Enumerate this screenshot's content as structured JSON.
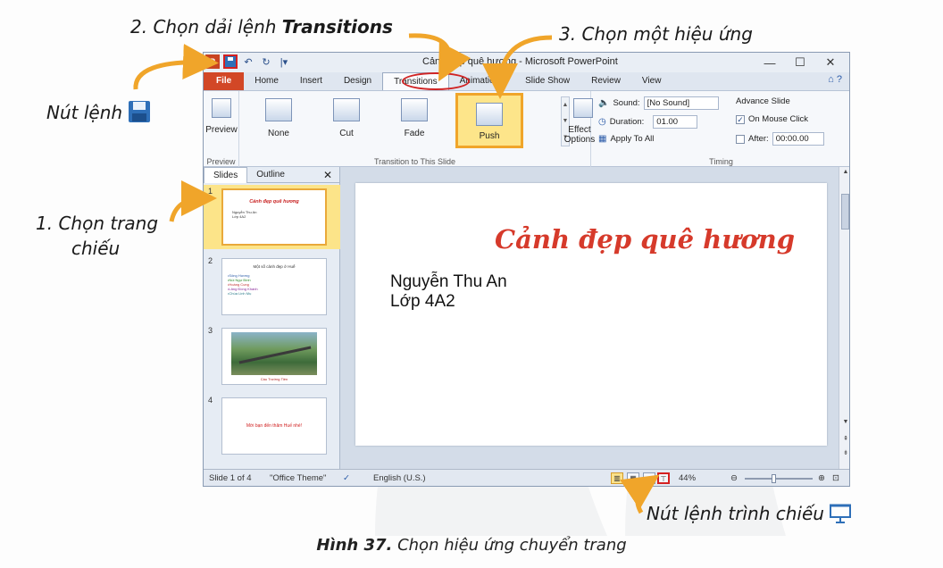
{
  "annotations": {
    "step2_prefix": "2. Chọn dải lệnh ",
    "step2_bold": "Transitions",
    "step3": "3. Chọn một hiệu ứng",
    "save_note": "Nút lệnh",
    "step1_line1": "1. Chọn trang",
    "step1_line2": "chiếu",
    "slideshow_note": "Nút lệnh trình chiếu",
    "caption_bold": "Hình 37.",
    "caption_rest": " Chọn hiệu ứng chuyển trang"
  },
  "window": {
    "title": "Cảnh đẹp quê hương - Microsoft PowerPoint",
    "controls": [
      "—",
      "☐",
      "✕"
    ]
  },
  "tabs": [
    "File",
    "Home",
    "Insert",
    "Design",
    "Transitions",
    "Animations",
    "Slide Show",
    "Review",
    "View"
  ],
  "ribbon": {
    "preview_label": "Preview",
    "preview_group": "Preview",
    "transition_group": "Transition to This Slide",
    "transitions": [
      "None",
      "Cut",
      "Fade",
      "Push"
    ],
    "selected_transition": "Push",
    "effect_options": "Effect Options",
    "timing_group": "Timing",
    "sound_label": "Sound:",
    "sound_value": "[No Sound]",
    "duration_label": "Duration:",
    "duration_value": "01.00",
    "apply_all": "Apply To All",
    "advance_title": "Advance Slide",
    "on_mouse_click": "On Mouse Click",
    "on_mouse_click_checked": true,
    "after_label": "After:",
    "after_value": "00:00.00"
  },
  "panel": {
    "tab_slides": "Slides",
    "tab_outline": "Outline",
    "close": "✕",
    "thumbs": [
      {
        "num": "1",
        "title": "Cảnh đẹp quê hương",
        "sub1": "Nguyễn Thu An",
        "sub2": "Lớp 4A2"
      },
      {
        "num": "2",
        "head": "Một số cảnh đẹp ở Huế",
        "items": [
          "•Sông Hương",
          "•Núi Ngự Bình",
          "•Hoàng Cung",
          "•Lăng Đồng Khánh",
          "•Chùa Linh Mụ"
        ]
      },
      {
        "num": "3",
        "caption": "Cầu Trường Tiền"
      },
      {
        "num": "4",
        "text": "Mời bạn đến thăm Huế nhé!"
      }
    ]
  },
  "slide": {
    "title": "Cảnh đẹp quê hương",
    "name": "Nguyễn Thu An",
    "class": "Lớp 4A2"
  },
  "status": {
    "slide_info": "Slide 1 of 4",
    "theme": "\"Office Theme\"",
    "language": "English (U.S.)",
    "zoom": "44%"
  },
  "colors": {
    "accent_red": "#d02424",
    "arrow_orange": "#f0a52a",
    "file_tab": "#d24726",
    "slide_title": "#d63a2b"
  }
}
